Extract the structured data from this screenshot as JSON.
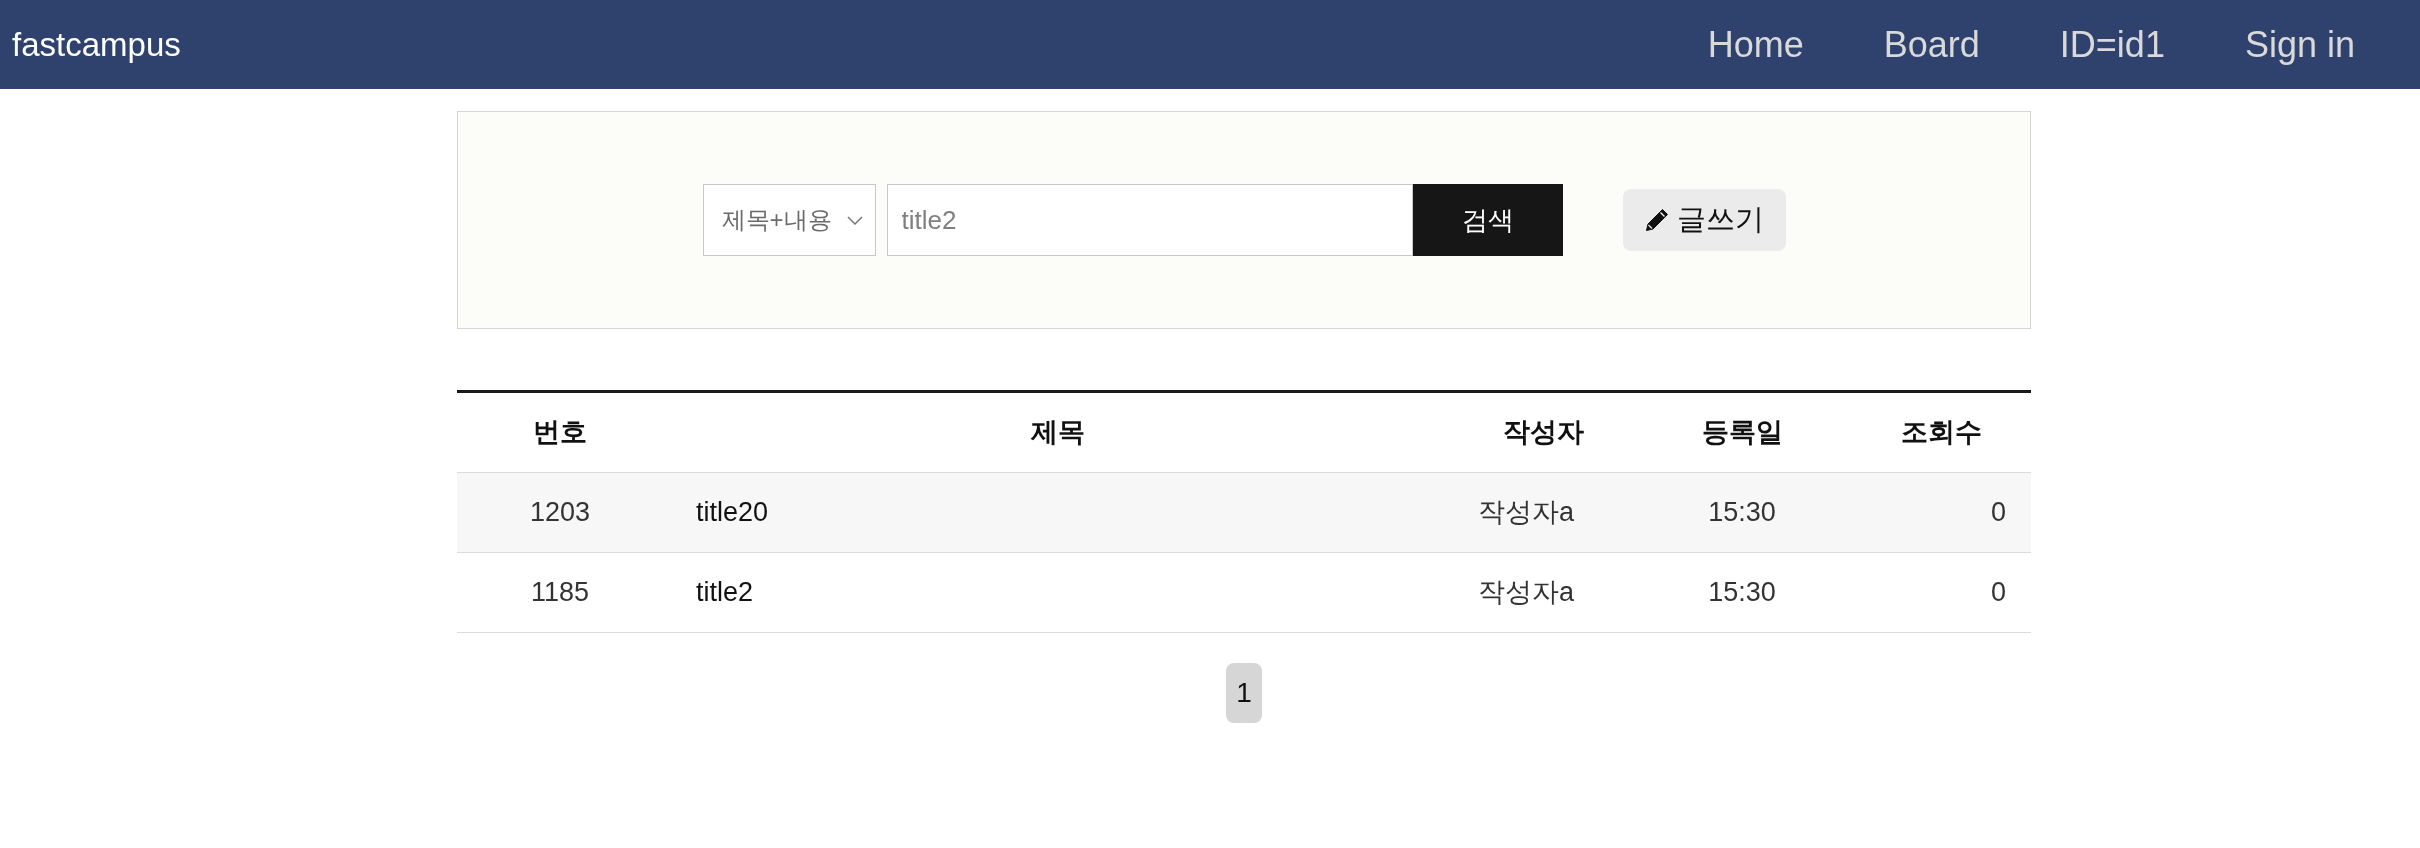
{
  "navbar": {
    "brand": "fastcampus",
    "links": [
      "Home",
      "Board",
      "ID=id1",
      "Sign in"
    ]
  },
  "search": {
    "filter": "제목+내용",
    "query": "title2",
    "submit": "검색",
    "write_button": "글쓰기"
  },
  "table": {
    "columns": [
      "번호",
      "제목",
      "작성자",
      "등록일",
      "조회수"
    ],
    "rows": [
      {
        "cells": [
          "1203",
          "title20",
          "작성자a",
          "15:30",
          "0"
        ]
      },
      {
        "cells": [
          "1185",
          "title2",
          "작성자a",
          "15:30",
          "0"
        ]
      }
    ]
  },
  "pagination": [
    {
      "label": "1",
      "selected": true
    }
  ]
}
